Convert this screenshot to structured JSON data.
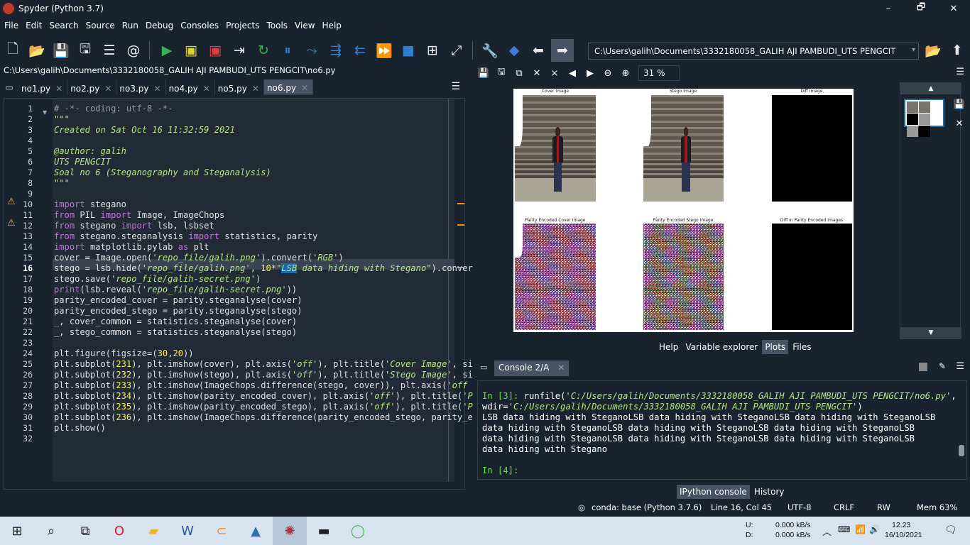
{
  "window": {
    "title": "Spyder (Python 3.7)",
    "minimize": "–",
    "maximize": "🗗",
    "close": "✕"
  },
  "menu": [
    "File",
    "Edit",
    "Search",
    "Source",
    "Run",
    "Debug",
    "Consoles",
    "Projects",
    "Tools",
    "View",
    "Help"
  ],
  "toolbar": {
    "working_dir": "C:\\Users\\galih\\Documents\\3332180058_GALIH AJI PAMBUDI_UTS PENGCIT"
  },
  "editor": {
    "file_path": "C:\\Users\\galih\\Documents\\3332180058_GALIH AJI PAMBUDI_UTS PENGCIT\\no6.py",
    "tabs": [
      {
        "label": "no1.py"
      },
      {
        "label": "no2.py"
      },
      {
        "label": "no3.py"
      },
      {
        "label": "no4.py"
      },
      {
        "label": "no5.py"
      },
      {
        "label": "no6.py"
      }
    ],
    "current_line": 16
  },
  "plots": {
    "zoom": "31 %",
    "subplots": [
      {
        "title": "Cover Image"
      },
      {
        "title": "Stego Image"
      },
      {
        "title": "Diff Image"
      },
      {
        "title": "Parity Encoded Cover Image"
      },
      {
        "title": "Parity Encoded Stego Image"
      },
      {
        "title": "Diff in Parity Encoded Images"
      }
    ]
  },
  "upper_tabs": [
    "Help",
    "Variable explorer",
    "Plots",
    "Files"
  ],
  "console": {
    "tab_label": "Console 2/A",
    "prompt_in3": "In [3]:",
    "cmd_prefix": " runfile(",
    "cmd_path": "'C:/Users/galih/Documents/3332180058_GALIH AJI PAMBUDI_UTS PENGCIT/no6.py'",
    "cmd_mid": ",",
    "wdir_prefix": "wdir=",
    "wdir_path": "'C:/Users/galih/Documents/3332180058_GALIH AJI PAMBUDI_UTS PENGCIT'",
    "wdir_suffix": ")",
    "output": "LSB data hiding with SteganoLSB data hiding with SteganoLSB data hiding with SteganoLSB data hiding with SteganoLSB data hiding with SteganoLSB data hiding with SteganoLSB data hiding with SteganoLSB data hiding with SteganoLSB data hiding with SteganoLSB data hiding with Stegano",
    "prompt_in4": "In [4]:"
  },
  "lower_tabs": [
    "IPython console",
    "History"
  ],
  "status": {
    "env": "conda: base (Python 3.7.6)",
    "position": "Line 16, Col 45",
    "encoding": "UTF-8",
    "eol": "CRLF",
    "perms": "RW",
    "mem": "Mem 63%"
  },
  "tray": {
    "up_label": "U:",
    "down_label": "D:",
    "up_speed": "0.000 kB/s",
    "down_speed": "0.000 kB/s",
    "time": "12.23",
    "date": "16/10/2021"
  },
  "code": {
    "l1": "# -*- coding: utf-8 -*-",
    "l2": "\"\"\"",
    "l3": "Created on Sat Oct 16 11:32:59 2021",
    "l5": "@author: galih",
    "l6": "UTS PENGCIT",
    "l7": "Soal no 6 (Steganography and Steganalysis)",
    "l8": "\"\"\""
  }
}
